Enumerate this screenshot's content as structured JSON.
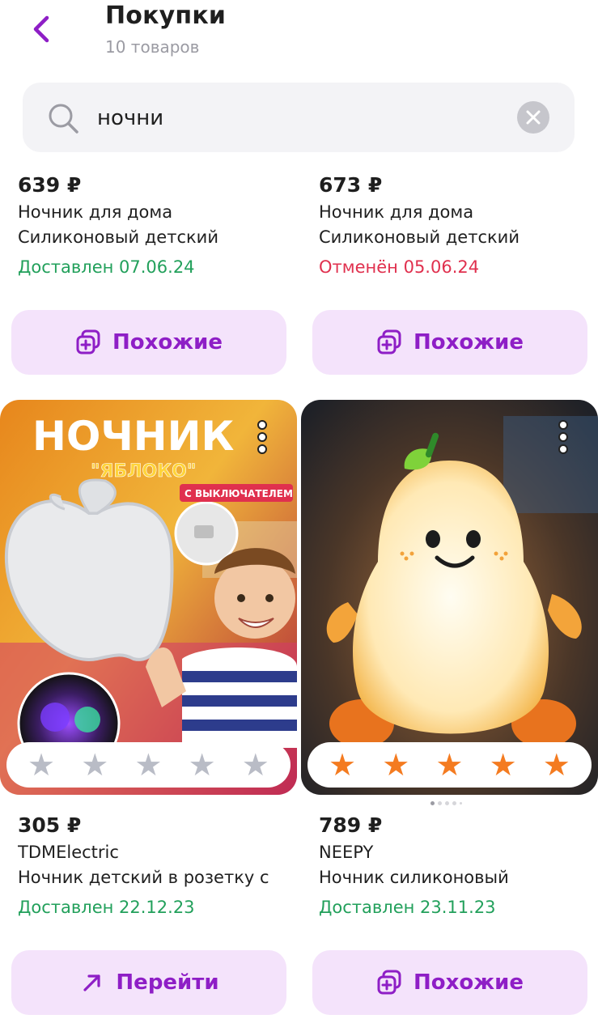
{
  "header": {
    "title": "Покупки",
    "subtitle": "10 товаров"
  },
  "search": {
    "value": "ночни"
  },
  "colors": {
    "accent": "#8e1ec6",
    "button_bg": "#f4e3fb",
    "delivered": "#22a05b",
    "cancelled": "#e0304e",
    "star_active": "#f47b20",
    "star_inactive": "#b9bcc6"
  },
  "products": [
    {
      "price": "639 ₽",
      "line1": "Ночник для дома",
      "line2": "Силиконовый детский",
      "status": "Доставлен 07.06.24",
      "button": "Похожие",
      "button_icon": "similar-icon"
    },
    {
      "price": "673 ₽",
      "line1": "Ночник для дома",
      "line2": "Силиконовый детский",
      "status": "Отменён 05.06.24",
      "button": "Похожие",
      "button_icon": "similar-icon"
    },
    {
      "image_text_1": "НОЧНИК",
      "image_text_2": "\"ЯБЛОКО\"",
      "image_text_3": "С ВЫКЛЮЧАТЕЛЕМ",
      "rating": 0,
      "price": "305 ₽",
      "line1": "TDMElectric",
      "line2": "Ночник детский в розетку с",
      "status": "Доставлен 22.12.23",
      "button": "Перейти",
      "button_icon": "arrow-up-right-icon"
    },
    {
      "rating": 5,
      "price": "789 ₽",
      "line1": "NEEPY",
      "line2": "Ночник силиконовый",
      "status": "Доставлен 23.11.23",
      "button": "Похожие",
      "button_icon": "similar-icon"
    }
  ]
}
